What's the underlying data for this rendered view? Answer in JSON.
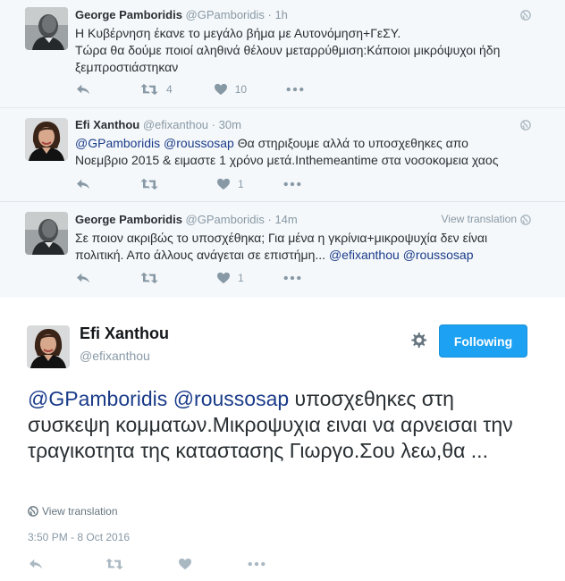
{
  "tweets": [
    {
      "name": "George Pamboridis",
      "handle": "@GPamboridis",
      "time": "· 1h",
      "text_lines": [
        "Η Κυβέρνηση έκανε το μεγάλο βήμα με Αυτονόμηση+ΓεΣΥ.",
        "Τώρα θα δούμε ποιοί αληθινά θέλουν μεταρρύθμιση:Κάποιοι μικρόψυχοι ήδη",
        "ξεμπροστιάστηκαν"
      ],
      "retweets": "4",
      "likes": "10"
    },
    {
      "name": "Efi Xanthou",
      "handle": "@efixanthou",
      "time": "· 30m",
      "mention1": "@GPamboridis",
      "mention2": "@roussosap",
      "text_rest": " Θα στηριξουμε αλλά το υποσχεθηκες απο",
      "text_line2": "Νοεμβριο 2015 & ειμαστε 1 χρόνο μετά.Inthemeantime στα νοσοκομεια χαος",
      "retweets": "",
      "likes": "1"
    },
    {
      "name": "George Pamboridis",
      "handle": "@GPamboridis",
      "time": "· 14m",
      "view_translation": "View translation",
      "text_line1": "Σε ποιον ακριβώς το υποσχέθηκα; Για μένα η γκρίνια+μικροψυχία δεν είναι",
      "text_line2_start": "πολιτική. Απο άλλους ανάγεται σε επιστήμη... ",
      "mention1": "@efixanthou",
      "mention2": "@roussosap",
      "retweets": "",
      "likes": "1"
    }
  ],
  "main": {
    "name": "Efi Xanthou",
    "handle": "@efixanthou",
    "follow_label": "Following",
    "mention1": "@GPamboridis",
    "mention2": "@roussosap",
    "text_rest": " υποσχεθηκες στη συσκεψη κομματων.Μικροψυχια ειναι να αρνεισαι την τραγικοτητα της καταστασης Γιωργο.Σου λεω,θα ...",
    "view_translation": "View translation",
    "timestamp": "3:50 PM - 8 Oct 2016"
  },
  "colors": {
    "accent": "#1da1f2",
    "mention": "#1b3c8a",
    "muted": "#8899a6",
    "thread_bg": "#f5f8fa"
  },
  "icons": [
    "reply-icon",
    "retweet-icon",
    "like-icon",
    "more-icon",
    "globe-icon",
    "gear-icon"
  ]
}
